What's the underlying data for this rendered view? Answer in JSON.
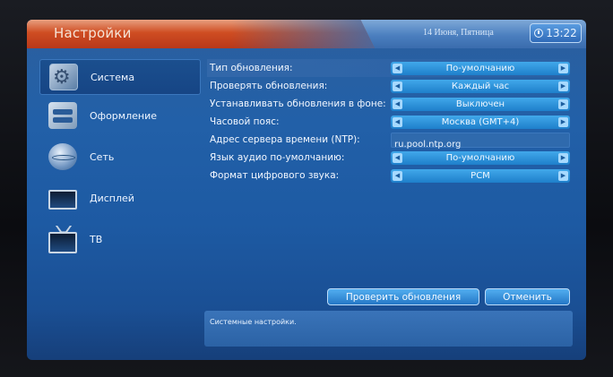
{
  "header": {
    "title": "Настройки",
    "date": "14 Июня, Пятница",
    "time": "13:22"
  },
  "sidebar": {
    "items": [
      {
        "label": "Система",
        "icon": "gear-icon",
        "selected": true
      },
      {
        "label": "Оформление",
        "icon": "theme-toggle-icon",
        "selected": false
      },
      {
        "label": "Сеть",
        "icon": "globe-icon",
        "selected": false
      },
      {
        "label": "Дисплей",
        "icon": "display-icon",
        "selected": false
      },
      {
        "label": "ТВ",
        "icon": "tv-icon",
        "selected": false
      }
    ]
  },
  "settings": [
    {
      "label": "Тип обновления:",
      "value": "По-умолчанию",
      "type": "selector"
    },
    {
      "label": "Проверять обновления:",
      "value": "Каждый час",
      "type": "selector"
    },
    {
      "label": "Устанавливать обновления в фоне:",
      "value": "Выключен",
      "type": "selector"
    },
    {
      "label": "Часовой пояс:",
      "value": "Москва (GMT+4)",
      "type": "selector"
    },
    {
      "label": "Адрес сервера времени (NTP):",
      "value": "ru.pool.ntp.org",
      "type": "text"
    },
    {
      "label": "Язык аудио по-умолчанию:",
      "value": "По-умолчанию",
      "type": "selector"
    },
    {
      "label": "Формат цифрового звука:",
      "value": "PCM",
      "type": "selector"
    }
  ],
  "buttons": {
    "check_updates": "Проверить обновления",
    "cancel": "Отменить"
  },
  "description": "Системные настройки.",
  "colors": {
    "title_accent": "#cf4d22",
    "selector": "#2a8fd6",
    "background": "#1d5aa3"
  }
}
